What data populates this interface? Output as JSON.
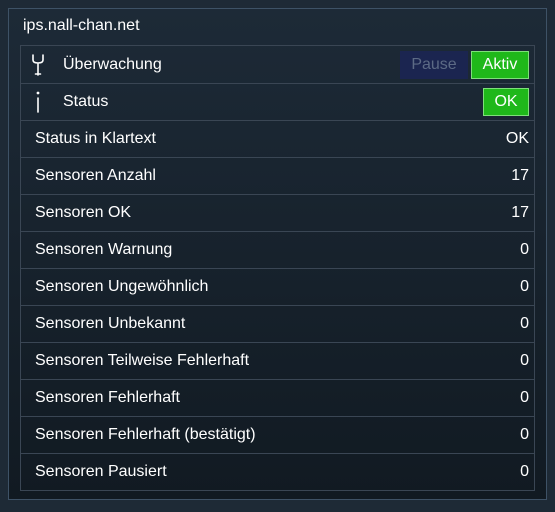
{
  "panel": {
    "title": "ips.nall-chan.net"
  },
  "monitoring": {
    "label": "Überwachung",
    "icon": "wrench-icon",
    "pause_label": "Pause",
    "active_label": "Aktiv"
  },
  "status": {
    "label": "Status",
    "icon": "info-icon",
    "button_label": "OK"
  },
  "rows": [
    {
      "label": "Status in Klartext",
      "value": "OK"
    },
    {
      "label": "Sensoren Anzahl",
      "value": "17"
    },
    {
      "label": "Sensoren OK",
      "value": "17"
    },
    {
      "label": "Sensoren Warnung",
      "value": "0"
    },
    {
      "label": "Sensoren Ungewöhnlich",
      "value": "0"
    },
    {
      "label": "Sensoren Unbekannt",
      "value": "0"
    },
    {
      "label": "Sensoren Teilweise Fehlerhaft",
      "value": "0"
    },
    {
      "label": "Sensoren Fehlerhaft",
      "value": "0"
    },
    {
      "label": "Sensoren Fehlerhaft (bestätigt)",
      "value": "0"
    },
    {
      "label": "Sensoren Pausiert",
      "value": "0"
    }
  ],
  "colors": {
    "active_green": "#1fb81a",
    "pause_navy": "#1b2550",
    "background": "#1e2a36"
  }
}
